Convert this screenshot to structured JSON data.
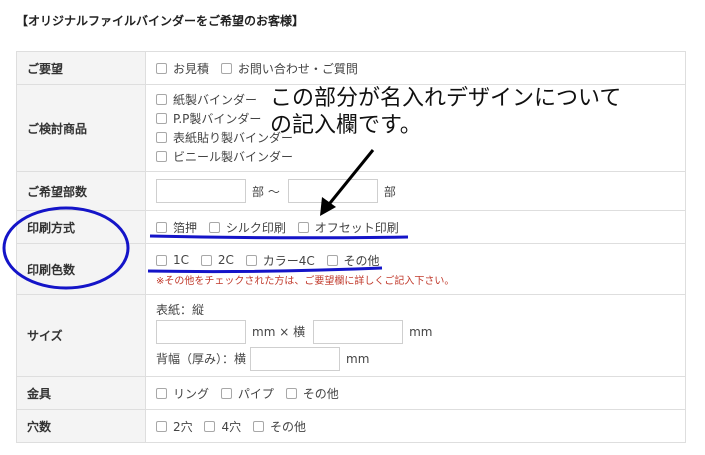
{
  "heading": "【オリジナルファイルバインダーをご希望のお客様】",
  "rows": {
    "request": {
      "label": "ご要望",
      "options": [
        "お見積",
        "お問い合わせ・ご質問"
      ]
    },
    "product": {
      "label": "ご検討商品",
      "options": [
        "紙製バインダー",
        "P.P製バインダー",
        "表紙貼り製バインダー",
        "ビニール製バインダー"
      ]
    },
    "quantity": {
      "label": "ご希望部数",
      "unit_from": "部 ～",
      "unit_to": "部"
    },
    "print_method": {
      "label": "印刷方式",
      "options": [
        "箔押",
        "シルク印刷",
        "オフセット印刷"
      ]
    },
    "print_colors": {
      "label": "印刷色数",
      "options": [
        "1C",
        "2C",
        "カラー4C",
        "その他"
      ],
      "note": "※その他をチェックされた方は、ご要望欄に詳しくご記入下さい。"
    },
    "size": {
      "label": "サイズ",
      "cover_label": "表紙：縦",
      "mm": "mm",
      "times_side": "mm × 横",
      "spine_label": "背幅（厚み）：横"
    },
    "fittings": {
      "label": "金具",
      "options": [
        "リング",
        "パイプ",
        "その他"
      ]
    },
    "holes": {
      "label": "穴数",
      "options": [
        "2穴",
        "4穴",
        "その他"
      ]
    }
  },
  "annotation": {
    "line1": "この部分が名入れデザインについて",
    "line2": "の記入欄です。",
    "ink_color": "#1414c8",
    "arrow_color": "#000000"
  }
}
